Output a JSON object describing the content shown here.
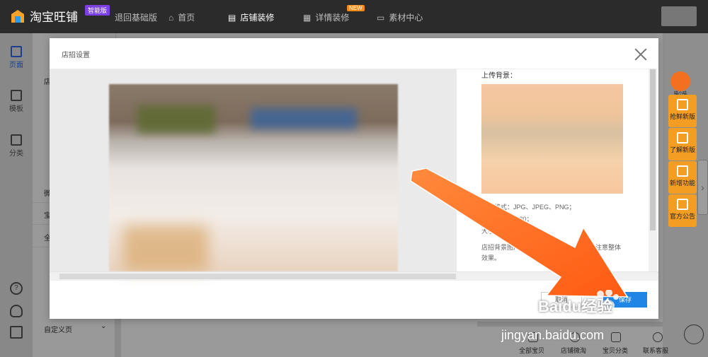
{
  "topbar": {
    "logo": "淘宝旺铺",
    "vip_badge": "智能版",
    "back_basic": "退回基础版",
    "home": "首页",
    "store_decor": "店铺装修",
    "detail_decor": "详情装修",
    "new_badge": "NEW",
    "material_center": "素材中心"
  },
  "rail": {
    "page": "页面",
    "template": "模板",
    "category": "分类",
    "help_icon": "?"
  },
  "left_panel": {
    "rows": [
      "店",
      "微",
      "宝",
      "全"
    ],
    "custom_page": "自定义页"
  },
  "float_buttons": [
    "抢鲜新版",
    "了解新版",
    "新增功能",
    "官方公告"
  ],
  "mascot_label": "喵小喵",
  "bottom_nav": [
    "全部宝贝",
    "店铺微淘",
    "宝贝分类",
    "联系客服"
  ],
  "modal": {
    "title": "店招设置",
    "upload_label": "上传背景：",
    "info_format": "图片格式：JPG、JPEG、PNG；",
    "info_size": "50x580；",
    "info_size_prefix": "大小",
    "info_size_suffix": "左右；",
    "info_tip_1": "店招背景图片",
    "info_tip_2": "时注意整体",
    "info_tip_3": "效果。",
    "cancel": "取消",
    "save": "保存"
  },
  "colors": {
    "accent": "#1f86e6",
    "arrow": "#ff6a1c",
    "float_button": "#f39e23",
    "vip_badge": "#7b3fe4"
  },
  "watermark": "Baidu经验",
  "watermark_url": "jingyan.baidu.com"
}
